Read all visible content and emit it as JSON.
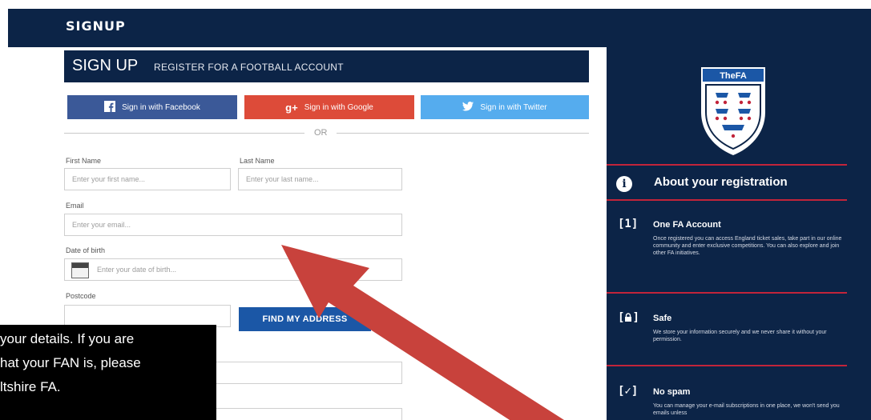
{
  "header": {
    "title": "SIGNUP"
  },
  "form": {
    "title": "SIGN UP",
    "subtitle": "REGISTER FOR A FOOTBALL ACCOUNT",
    "social": {
      "facebook": {
        "icon": "facebook-icon",
        "label": "Sign in with Facebook"
      },
      "google": {
        "icon": "google-plus-icon",
        "glyph": "g+",
        "label": "Sign in with Google"
      },
      "twitter": {
        "icon": "twitter-icon",
        "label": "Sign in with Twitter"
      }
    },
    "divider_text": "OR",
    "first_name": {
      "label": "First Name",
      "placeholder": "Enter your first name..."
    },
    "last_name": {
      "label": "Last Name",
      "placeholder": "Enter your last name..."
    },
    "email": {
      "label": "Email",
      "placeholder": "Enter your email..."
    },
    "dob": {
      "label": "Date of birth",
      "placeholder": "Enter your date of birth..."
    },
    "postcode": {
      "label": "Postcode"
    },
    "find_button": "FIND MY ADDRESS"
  },
  "sidebar": {
    "logo_text": "TheFA",
    "about_heading": "About your registration",
    "items": [
      {
        "icon": "[1]",
        "title": "One FA Account",
        "text": "Once registered you can access England ticket sales, take part in our online community and enter exclusive competitions. You can also explore and join other FA initiatives."
      },
      {
        "icon": "[lock]",
        "title": "Safe",
        "text": "We store your information securely and we never share it without your permission."
      },
      {
        "icon": "[✓]",
        "title": "No spam",
        "text": "You can manage your e-mail subscriptions in one place, we won't send you emails unless"
      }
    ]
  },
  "caption": {
    "lines": [
      "your details. If you are",
      "hat your FAN is, please",
      "ltshire FA."
    ]
  },
  "colors": {
    "navy": "#0c2447",
    "facebook": "#3b5998",
    "google": "#dd4b39",
    "twitter": "#55acee",
    "accent_red": "#c2243a",
    "button_blue": "#1b57a6",
    "arrow_red": "#c8423c"
  }
}
